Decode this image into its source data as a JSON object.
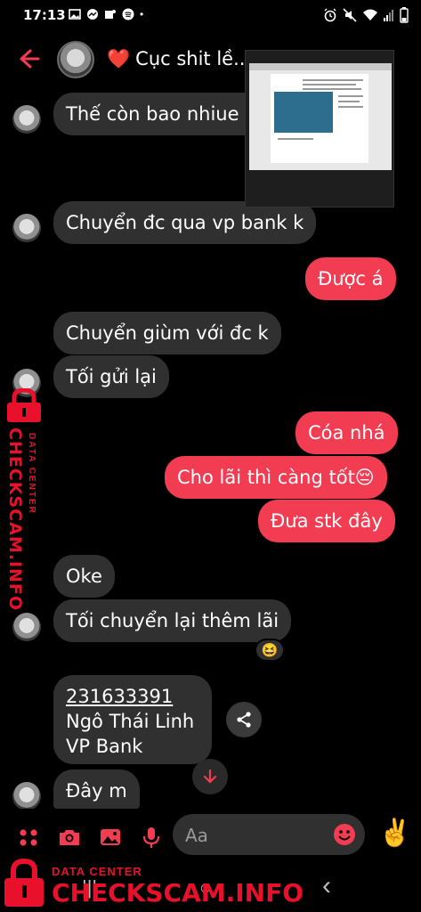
{
  "status_bar": {
    "time": "17:13",
    "dot": "•"
  },
  "header": {
    "heart": "❤️",
    "title": "Cục shit lề..."
  },
  "messages": [
    {
      "side": "in",
      "text": "Thế còn bao nhiue đ"
    },
    {
      "side": "in",
      "text": "Chuyển đc qua vp bank k"
    },
    {
      "side": "out",
      "text": "Được á"
    },
    {
      "side": "in",
      "text": "Chuyển giùm với đc k"
    },
    {
      "side": "in",
      "text": "Tối gửi lại"
    },
    {
      "side": "out",
      "text": "Cóa nhá"
    },
    {
      "side": "out",
      "text": "Cho lãi thì càng tốt😔"
    },
    {
      "side": "out",
      "text": "Đưa stk đây"
    },
    {
      "side": "in",
      "text": "Oke"
    },
    {
      "side": "in",
      "text": "Tối chuyển lại thêm lãi"
    },
    {
      "side": "in",
      "text": "Đây m"
    }
  ],
  "reaction": "😆",
  "account_card": {
    "number": "231633391",
    "name": "Ngô Thái Linh",
    "bank": "VP Bank"
  },
  "composer": {
    "placeholder": "Aa",
    "quick_emoji": "✌️"
  },
  "watermark": {
    "side_main": "CHECKSCAM.INFO",
    "side_sub": "DATA CENTER",
    "bottom_main": "CHECKSCAM.INFO",
    "bottom_sub": "DATA CENTER"
  },
  "nav": {
    "recents": "|||",
    "home": "○",
    "back": "‹"
  },
  "colors": {
    "outgoing_bubble": "#f23c52",
    "incoming_bubble": "#303030",
    "accent": "#f23c52",
    "watermark": "#e8102a"
  },
  "icons": [
    "back-arrow-icon",
    "menu-dots-icon",
    "camera-icon",
    "image-icon",
    "microphone-icon",
    "emoji-icon",
    "share-icon",
    "arrow-down-icon",
    "lock-icon"
  ]
}
